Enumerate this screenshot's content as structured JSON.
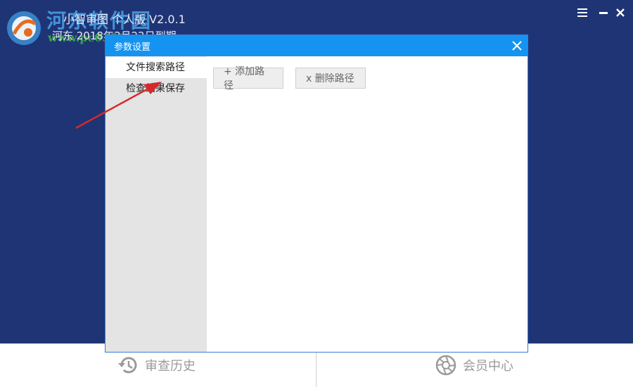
{
  "app": {
    "title": "小智审图 个人版 V2.0.1",
    "subtitle": "河东 2018年3月22日到期"
  },
  "watermark": {
    "text": "河东软件园",
    "url": "www.pc0359.cn"
  },
  "window_controls": {
    "menu_icon": "hamburger-icon",
    "minimize_icon": "minimize-icon",
    "close_icon": "close-icon"
  },
  "dialog": {
    "title": "参数设置",
    "sidebar": [
      {
        "label": "文件搜索路径",
        "active": true
      },
      {
        "label": "检查结果保存",
        "active": false
      }
    ],
    "buttons": {
      "add_path": "+ 添加路径",
      "delete_path": "x 删除路径"
    }
  },
  "bottom": {
    "history_label": "审查历史",
    "member_label": "会员中心"
  },
  "colors": {
    "background": "#1e3475",
    "dialog_title": "#1593f0",
    "sidebar": "#e4e4e4",
    "annotation_arrow": "#d42a2a"
  }
}
